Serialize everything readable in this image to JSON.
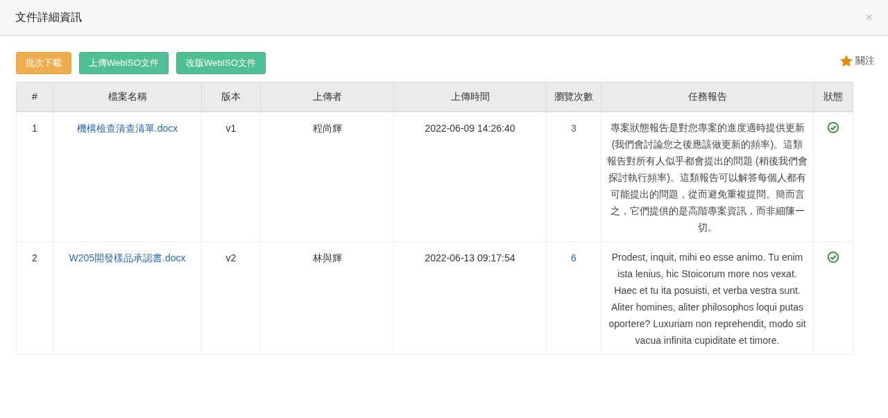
{
  "dialog": {
    "title": "文件詳細資訊",
    "close": "×"
  },
  "toolbar": {
    "buttons": [
      {
        "label": "批次下載",
        "kind": "warning"
      },
      {
        "label": "上傳WebISO文件",
        "kind": "success"
      },
      {
        "label": "改版WebISO文件",
        "kind": "success"
      }
    ],
    "follow": {
      "label": "關注",
      "starred": true
    }
  },
  "table": {
    "columns": [
      "#",
      "檔案名稱",
      "版本",
      "上傳者",
      "上傳時間",
      "瀏覽次數",
      "任務報告",
      "狀態"
    ],
    "rows": [
      {
        "index": "1",
        "file": "機構檢查清查清單.docx",
        "version": "v1",
        "uploader": "程尚輝",
        "time": "2022-06-09 14:26:40",
        "views": "3",
        "report": "專案狀態報告是對您專案的進度適時提供更新 (我們會討論您之後應該做更新的頻率)。這類報告對所有人似乎都會提出的問題 (稍後我們會探討執行頻率)。這類報告可以解答每個人都有可能提出的問題，從而避免重複提問。簡而言之，它們提供的是高階專案資訊，而非細陳一切。",
        "approved": true
      },
      {
        "index": "2",
        "file": "W205開發樣品承認書.docx",
        "version": "v2",
        "uploader": "林與輝",
        "time": "2022-06-13 09:17:54",
        "views": "6",
        "report": "Prodest, inquit, mihi eo esse animo. Tu enim ista lenius, hic Stoicorum more nos vexat. Haec et tu ita posuisti, et verba vestra sunt. Aliter homines, aliter philosophos loqui putas oportere? Luxuriam non reprehendit, modo sit vacua infinita cupiditate et timore.",
        "approved": true
      }
    ]
  }
}
